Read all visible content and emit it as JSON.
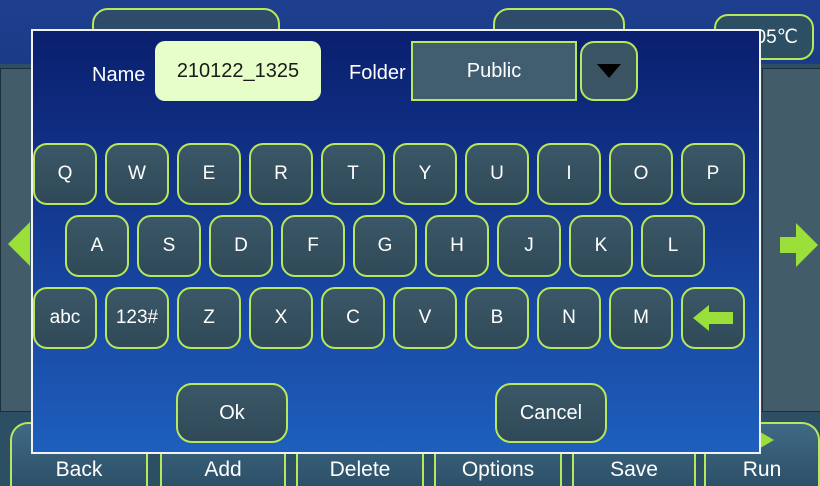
{
  "background": {
    "temperature": "05℃",
    "bottom_buttons": [
      "Back",
      "Add",
      "Delete",
      "Options",
      "Save",
      "Run"
    ]
  },
  "dialog": {
    "name_label": "Name",
    "name_value": "210122_1325",
    "folder_label": "Folder",
    "folder_value": "Public",
    "keyboard": {
      "row1": [
        "Q",
        "W",
        "E",
        "R",
        "T",
        "Y",
        "U",
        "I",
        "O",
        "P"
      ],
      "row2": [
        "A",
        "S",
        "D",
        "F",
        "G",
        "H",
        "J",
        "K",
        "L"
      ],
      "row3": [
        "abc",
        "123#",
        "Z",
        "X",
        "C",
        "V",
        "B",
        "N",
        "M"
      ]
    },
    "ok_label": "Ok",
    "cancel_label": "Cancel"
  },
  "colors": {
    "accent": "#b7e85c",
    "arrow_green": "#9be03a",
    "input_bg": "#e6ffc8"
  }
}
